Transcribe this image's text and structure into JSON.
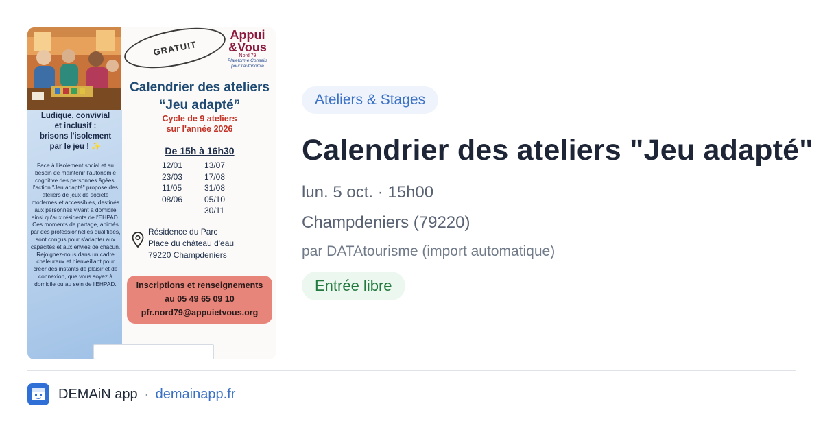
{
  "event": {
    "category": "Ateliers & Stages",
    "title": "Calendrier des ateliers \"Jeu adapté\"",
    "date_time": "lun. 5 oct. · 15h00",
    "location": "Champdeniers (79220)",
    "organizer": "par DATAtourisme (import automatique)",
    "price": "Entrée libre"
  },
  "poster": {
    "badge": "GRATUIT",
    "logo_line1": "Appui",
    "logo_line2": "&Vous",
    "logo_region": "Nord 79",
    "logo_tagline_1": "Plateforme Conseils",
    "logo_tagline_2": "pour l'autonomie",
    "headline_1": "Ludique, convivial",
    "headline_2": "et inclusif :",
    "headline_3": "brisons l'isolement",
    "headline_4": "par le jeu ! ✨",
    "body": "Face à l'isolement social et au besoin de maintenir l'autonomie cognitive des personnes âgées, l'action \"Jeu adapté\" propose des ateliers de jeux de société modernes et accessibles, destinés aux personnes vivant à domicile ainsi qu'aux résidents de l'EHPAD. Ces moments de partage, animés par des professionnelles qualifiées, sont conçus pour s'adapter aux capacités et aux envies de chacun. Rejoignez-nous dans un cadre chaleureux et bienveillant pour créer des instants de plaisir et de connexion, que vous soyez à domicile ou au sein de l'EHPAD.",
    "title": "Calendrier des ateliers",
    "subtitle": "“Jeu adapté”",
    "cycle_1": "Cycle de 9 ateliers",
    "cycle_2": "sur l'année 2026",
    "hours": "De 15h à 16h30",
    "dates_left": [
      "12/01",
      "23/03",
      "11/05",
      "08/06"
    ],
    "dates_right": [
      "13/07",
      "17/08",
      "31/08",
      "05/10",
      "30/11"
    ],
    "address_1": "Résidence du Parc",
    "address_2": "Place du château d'eau",
    "address_3": "79220 Champdeniers",
    "contact_1": "Inscriptions et renseignements",
    "contact_2": "au  05 49 65 09 10",
    "contact_3": "pfr.nord79@appuietvous.org"
  },
  "footer": {
    "app_name": "DEMAiN app",
    "separator": "·",
    "domain": "demainapp.fr"
  },
  "colors": {
    "category_bg": "#eef3fc",
    "category_text": "#3b71c4",
    "price_bg": "#ecf7ef",
    "price_text": "#237a3f",
    "link": "#3b71c4",
    "logo_bg": "#2f6fd6"
  },
  "icons": {
    "app_logo": "demain-app-icon",
    "map_pin": "map-pin-icon"
  }
}
